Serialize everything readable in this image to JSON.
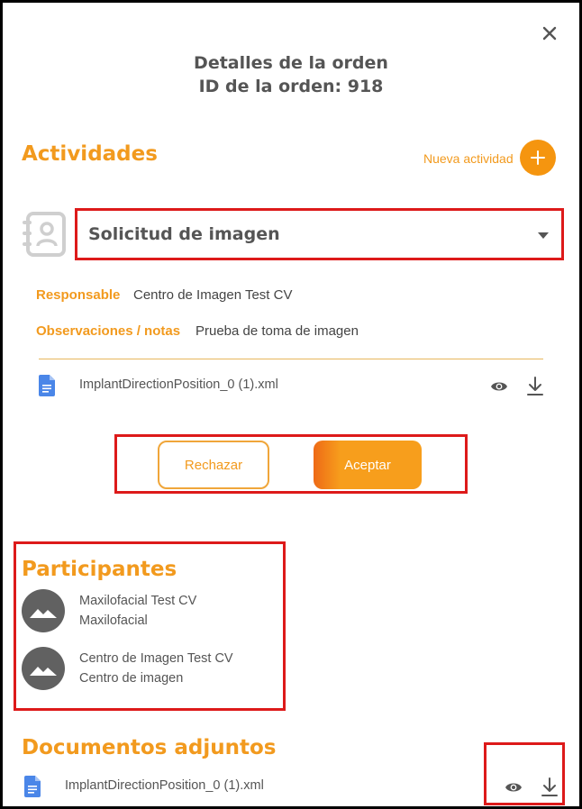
{
  "header": {
    "title_line1": "Detalles de la orden",
    "title_line2": "ID de la orden: 918"
  },
  "activities": {
    "heading": "Actividades",
    "new_activity_label": "Nueva actividad",
    "selected_activity": "Solicitud de imagen",
    "responsable_label": "Responsable",
    "responsable_value": "Centro de Imagen Test CV",
    "notes_label": "Observaciones / notas",
    "notes_value": "Prueba de toma de imagen",
    "file_name": "ImplantDirectionPosition_0 (1).xml",
    "reject_label": "Rechazar",
    "accept_label": "Aceptar"
  },
  "participants": {
    "heading": "Participantes",
    "items": [
      {
        "name": "Maxilofacial Test CV",
        "role": "Maxilofacial"
      },
      {
        "name": "Centro de Imagen Test CV",
        "role": "Centro de imagen"
      }
    ]
  },
  "documents": {
    "heading": "Documentos adjuntos",
    "file_name": "ImplantDirectionPosition_0 (1).xml"
  },
  "colors": {
    "accent": "#f29a1e",
    "highlight_border": "#dd1a1a",
    "avatar": "#616161"
  },
  "icons": [
    "close-icon",
    "plus-icon",
    "contact-book-icon",
    "dropdown-caret-icon",
    "file-icon",
    "eye-icon",
    "download-icon",
    "image-placeholder-icon"
  ]
}
